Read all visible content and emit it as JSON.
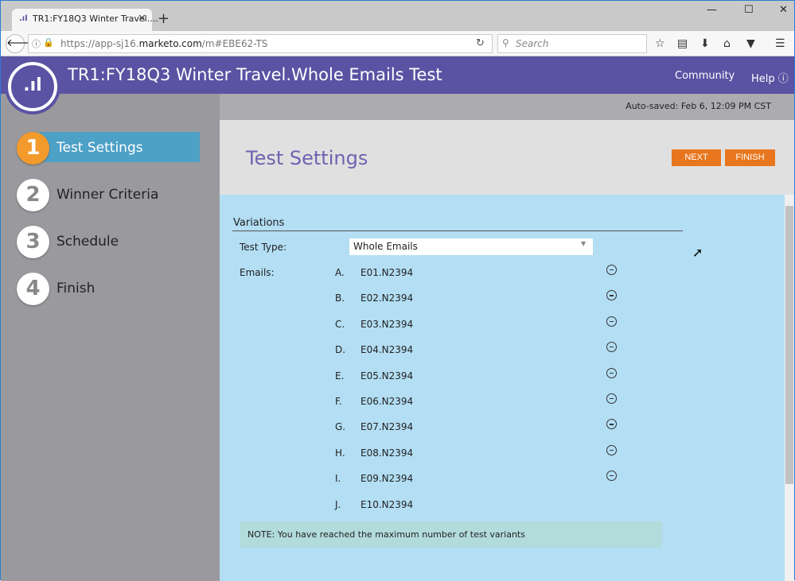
{
  "browser": {
    "tab_title": "TR1:FY18Q3 Winter Travel....",
    "url_prefix": "https://app-sj16.",
    "url_domain": "marketo.com",
    "url_suffix": "/m#EBE62-TS",
    "search_placeholder": "Search",
    "icons": [
      "back-icon",
      "info-icon",
      "lock-icon",
      "reload-icon",
      "search-icon",
      "star-icon",
      "clipboard-icon",
      "download-icon",
      "home-icon",
      "pocket-icon",
      "menu-icon"
    ]
  },
  "header": {
    "title": "TR1:FY18Q3 Winter Travel.Whole Emails Test",
    "community": "Community",
    "help": "Help",
    "brand_color": "#5a52a2"
  },
  "steps": [
    {
      "num": "1",
      "label": "Test Settings",
      "active": true
    },
    {
      "num": "2",
      "label": "Winner Criteria"
    },
    {
      "num": "3",
      "label": "Schedule"
    },
    {
      "num": "4",
      "label": "Finish"
    }
  ],
  "autosave": "Auto-saved: Feb 6, 12:09 PM CST",
  "page_title": "Test Settings",
  "buttons": {
    "next": "NEXT",
    "finish": "FINISH"
  },
  "variations": {
    "heading": "Variations",
    "test_type_label": "Test Type:",
    "test_type_value": "Whole Emails",
    "emails_label": "Emails:",
    "emails": [
      {
        "letter": "A.",
        "name": "E01.N2394",
        "removable": true
      },
      {
        "letter": "B.",
        "name": "E02.N2394",
        "removable": true
      },
      {
        "letter": "C.",
        "name": "E03.N2394",
        "removable": true
      },
      {
        "letter": "D.",
        "name": "E04.N2394",
        "removable": true
      },
      {
        "letter": "E.",
        "name": "E05.N2394",
        "removable": true
      },
      {
        "letter": "F.",
        "name": "E06.N2394",
        "removable": true
      },
      {
        "letter": "G.",
        "name": "E07.N2394",
        "removable": true
      },
      {
        "letter": "H.",
        "name": "E08.N2394",
        "removable": true
      },
      {
        "letter": "I.",
        "name": "E09.N2394",
        "removable": true
      },
      {
        "letter": "J.",
        "name": "E10.N2394",
        "removable": false
      }
    ],
    "note": "NOTE:  You have reached the maximum number of test variants"
  }
}
